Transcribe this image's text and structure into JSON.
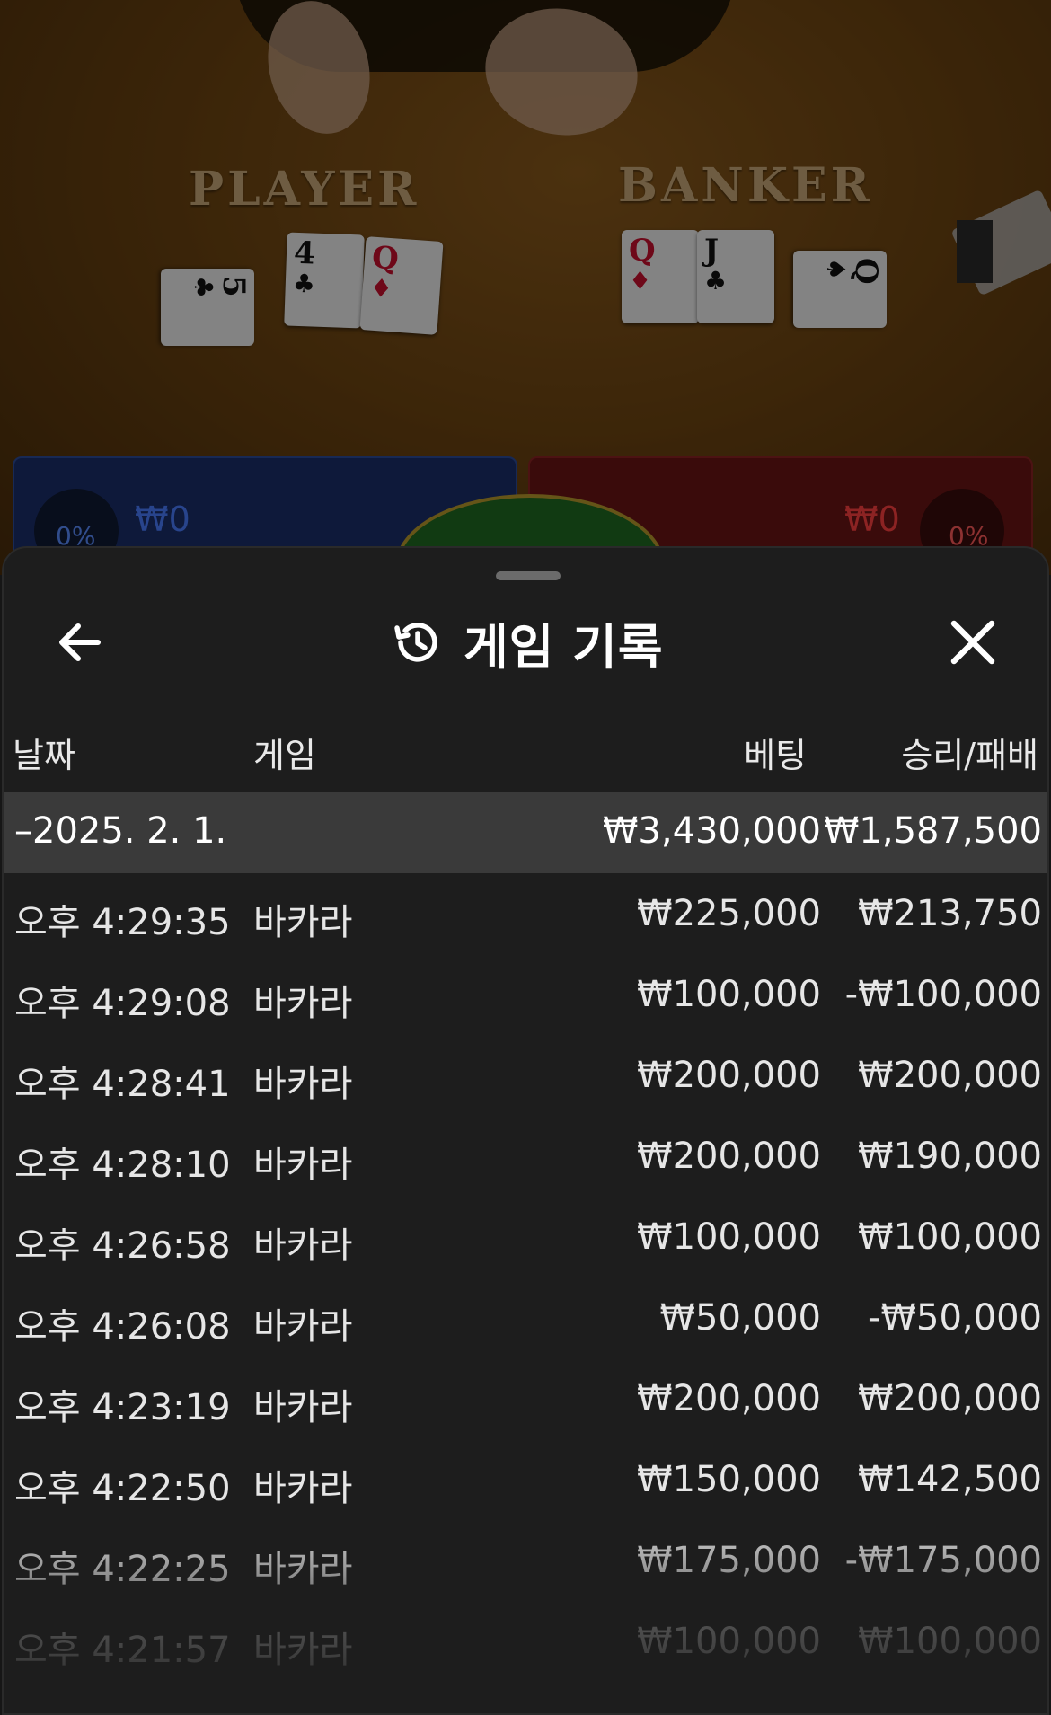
{
  "game_view": {
    "player_label": "PLAYER",
    "banker_label": "BANKER",
    "player_cards": [
      {
        "rank": "5",
        "suit": "♣",
        "color": "black"
      },
      {
        "rank": "4",
        "suit": "♣",
        "color": "black"
      },
      {
        "rank": "Q",
        "suit": "♦",
        "color": "red"
      }
    ],
    "banker_cards": [
      {
        "rank": "Q",
        "suit": "♦",
        "color": "red"
      },
      {
        "rank": "J",
        "suit": "♣",
        "color": "black"
      },
      {
        "rank": "Q",
        "suit": "♠",
        "color": "black"
      }
    ],
    "player_bet": {
      "percent": "0%",
      "amount": "₩0"
    },
    "banker_bet": {
      "percent": "0%",
      "amount": "₩0"
    },
    "colors": {
      "player": "#1b2f6a",
      "banker": "#6b1414",
      "table": "#6e4512"
    }
  },
  "sheet": {
    "title": "게임 기록",
    "icons": {
      "back": "arrow-left-icon",
      "history": "history-icon",
      "close": "close-icon"
    },
    "columns": {
      "date": "날짜",
      "game": "게임",
      "bet": "베팅",
      "win_loss": "승리/패배"
    },
    "date_group": {
      "date": "–2025. 2. 1.",
      "total_bet": "₩3,430,000",
      "total_win_loss": "₩1,587,500"
    },
    "rows": [
      {
        "time": "오후 4:29:35",
        "game": "바카라",
        "bet": "₩225,000",
        "win_loss": "₩213,750"
      },
      {
        "time": "오후 4:29:08",
        "game": "바카라",
        "bet": "₩100,000",
        "win_loss": "-₩100,000"
      },
      {
        "time": "오후 4:28:41",
        "game": "바카라",
        "bet": "₩200,000",
        "win_loss": "₩200,000"
      },
      {
        "time": "오후 4:28:10",
        "game": "바카라",
        "bet": "₩200,000",
        "win_loss": "₩190,000"
      },
      {
        "time": "오후 4:26:58",
        "game": "바카라",
        "bet": "₩100,000",
        "win_loss": "₩100,000"
      },
      {
        "time": "오후 4:26:08",
        "game": "바카라",
        "bet": "₩50,000",
        "win_loss": "-₩50,000"
      },
      {
        "time": "오후 4:23:19",
        "game": "바카라",
        "bet": "₩200,000",
        "win_loss": "₩200,000"
      },
      {
        "time": "오후 4:22:50",
        "game": "바카라",
        "bet": "₩150,000",
        "win_loss": "₩142,500"
      },
      {
        "time": "오후 4:22:25",
        "game": "바카라",
        "bet": "₩175,000",
        "win_loss": "-₩175,000"
      },
      {
        "time": "오후 4:21:57",
        "game": "바카라",
        "bet": "₩100,000",
        "win_loss": "₩100,000"
      }
    ]
  }
}
